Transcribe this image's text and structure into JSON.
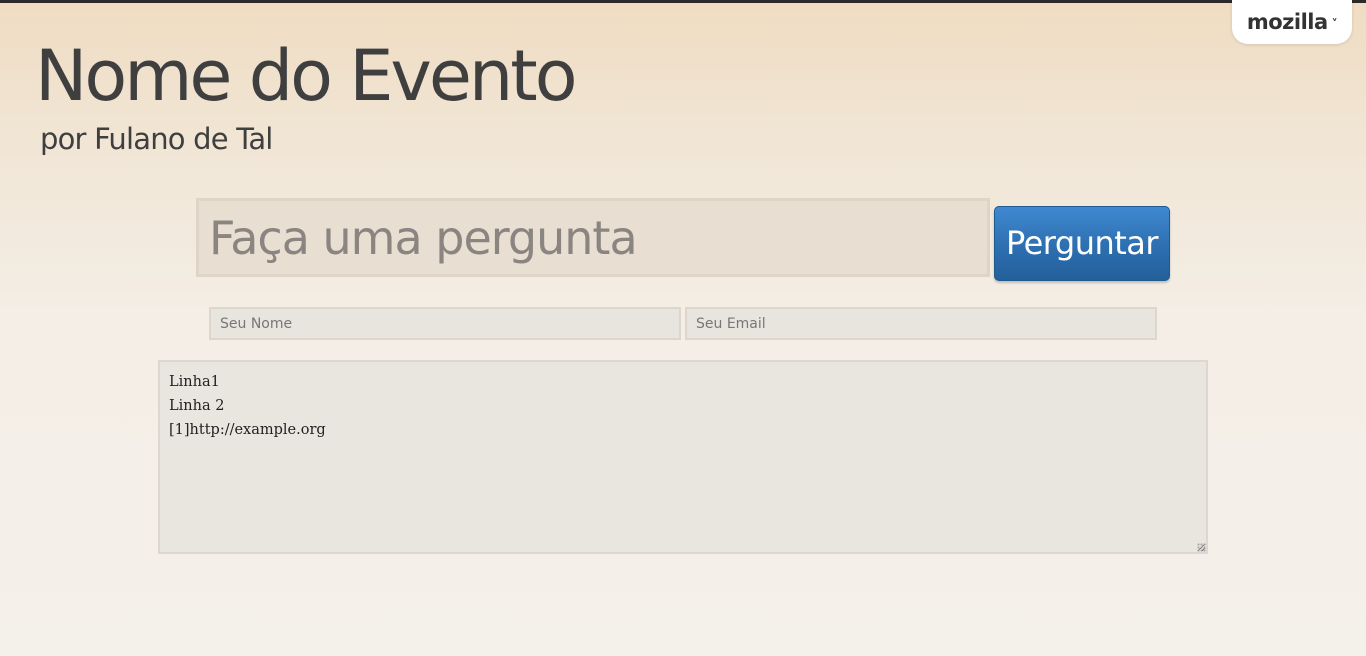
{
  "brand": {
    "label": "mozilla",
    "icon": "chevron-down-icon"
  },
  "event": {
    "title": "Nome do Evento",
    "author": "por Fulano de Tal"
  },
  "question_form": {
    "question_placeholder": "Faça uma pergunta",
    "ask_button_label": "Perguntar",
    "name_placeholder": "Seu Nome",
    "email_placeholder": "Seu Email",
    "message_value": "Linha1\nLinha 2\n[1]http://example.org"
  },
  "colors": {
    "title_text": "#3f3f3f",
    "button_blue": "#2d6fb0",
    "background_top": "#efdcc2",
    "background_bottom": "#f4f0ea"
  }
}
